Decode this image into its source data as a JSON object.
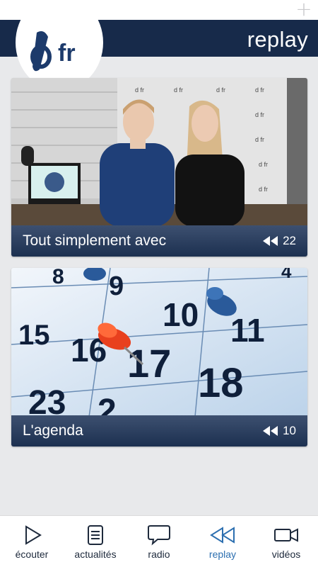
{
  "header": {
    "logo_text": "fr",
    "title": "replay",
    "add_icon": "plus-icon"
  },
  "cards": [
    {
      "title": "Tout simplement avec",
      "count": "22",
      "image": "studio-photo"
    },
    {
      "title": "L'agenda",
      "count": "10",
      "image": "calendar-photo"
    }
  ],
  "calendar_days": [
    "8",
    "9",
    "4",
    "10",
    "11",
    "15",
    "16",
    "17",
    "18",
    "23",
    "2"
  ],
  "nav": [
    {
      "label": "écouter",
      "icon": "play-icon",
      "active": false
    },
    {
      "label": "actualités",
      "icon": "news-icon",
      "active": false
    },
    {
      "label": "radio",
      "icon": "chat-bubble-icon",
      "active": false
    },
    {
      "label": "replay",
      "icon": "rewind-icon",
      "active": true
    },
    {
      "label": "vidéos",
      "icon": "video-camera-icon",
      "active": false
    }
  ],
  "colors": {
    "header_bg": "#172a4a",
    "active_nav": "#2c6fb0",
    "card_footer": "#2b3f5f",
    "page_bg": "#e8e9eb"
  }
}
